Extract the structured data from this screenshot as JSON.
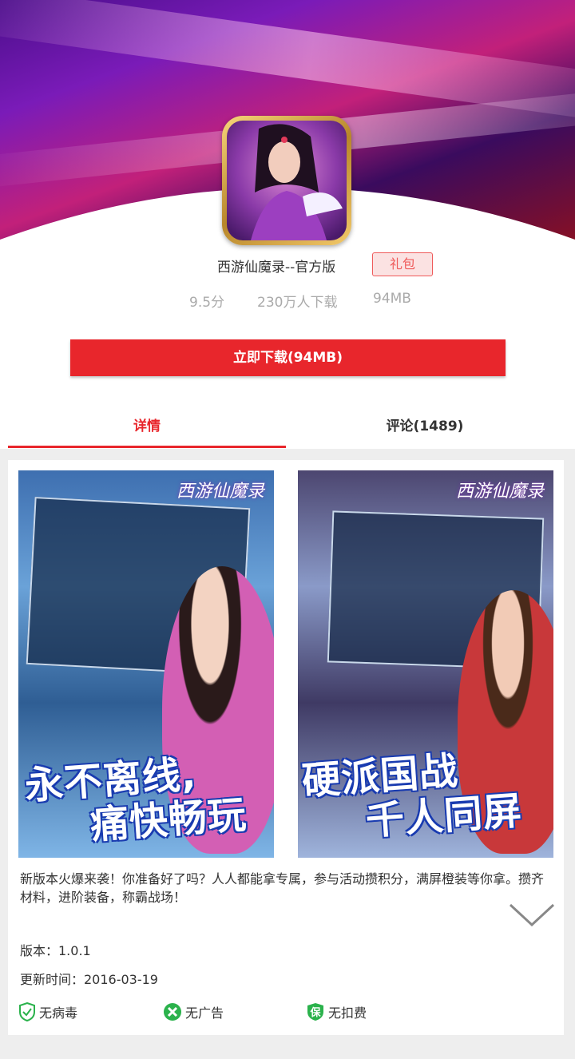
{
  "app": {
    "name": "西游仙魔录--官方版",
    "gift_label": "礼包",
    "rating": "9.5分",
    "downloads": "230万人下载",
    "size": "94MB"
  },
  "download_button": "立即下载(94MB)",
  "tabs": [
    {
      "label": "详情",
      "active": true
    },
    {
      "label": "评论(1489)",
      "active": false
    }
  ],
  "screenshots": [
    {
      "logo": "西游仙魔录",
      "caption_line1": "永不离线,",
      "caption_line2": "痛快畅玩"
    },
    {
      "logo": "西游仙魔录",
      "caption_line1": "硬派国战",
      "caption_line2": "千人同屏"
    }
  ],
  "description": "新版本火爆来袭！你准备好了吗？人人都能拿专属，参与活动攒积分，满屏橙装等你拿。攒齐材料，进阶装备，称霸战场！",
  "info": {
    "version": "版本：1.0.1",
    "updated": "更新时间：2016-03-19"
  },
  "badges": {
    "virus": "无病毒",
    "ads": "无广告",
    "fee": "无扣费",
    "fee_icon_char": "保"
  },
  "colors": {
    "accent": "#e8262c",
    "badge_green": "#2bb24c"
  }
}
